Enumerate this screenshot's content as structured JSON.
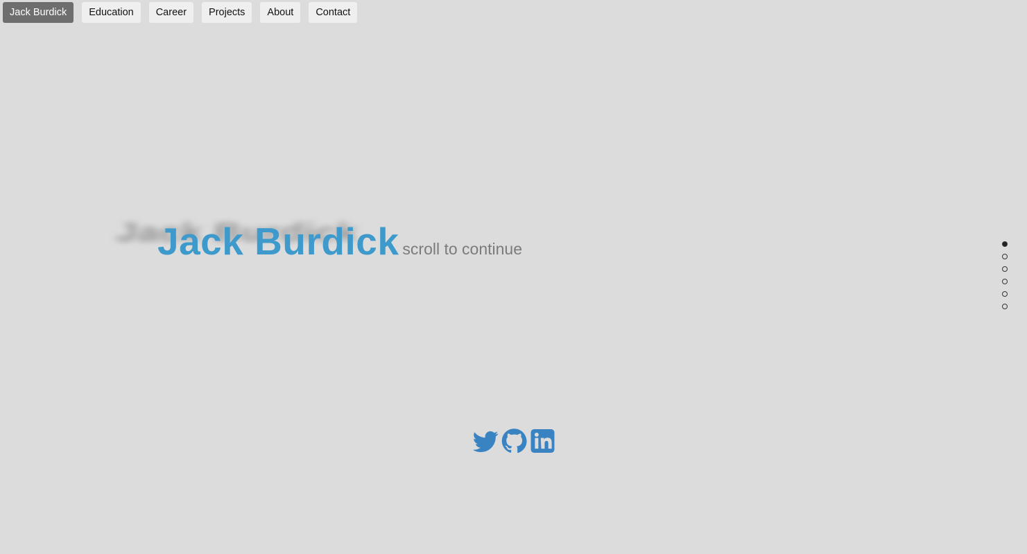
{
  "nav": {
    "items": [
      {
        "label": "Jack Burdick",
        "active": true
      },
      {
        "label": "Education",
        "active": false
      },
      {
        "label": "Career",
        "active": false
      },
      {
        "label": "Projects",
        "active": false
      },
      {
        "label": "About",
        "active": false
      },
      {
        "label": "Contact",
        "active": false
      }
    ]
  },
  "hero": {
    "name": "Jack Burdick",
    "subtitle": "scroll to continue"
  },
  "pager": {
    "count": 6,
    "active_index": 0
  },
  "social": {
    "icons": [
      "twitter-icon",
      "github-icon",
      "linkedin-icon"
    ],
    "color": "#3a83c2"
  },
  "colors": {
    "background": "#dddcdd",
    "accent": "#3d9acb",
    "nav_active_bg": "#6e6e6e",
    "nav_bg": "#f0efef"
  }
}
